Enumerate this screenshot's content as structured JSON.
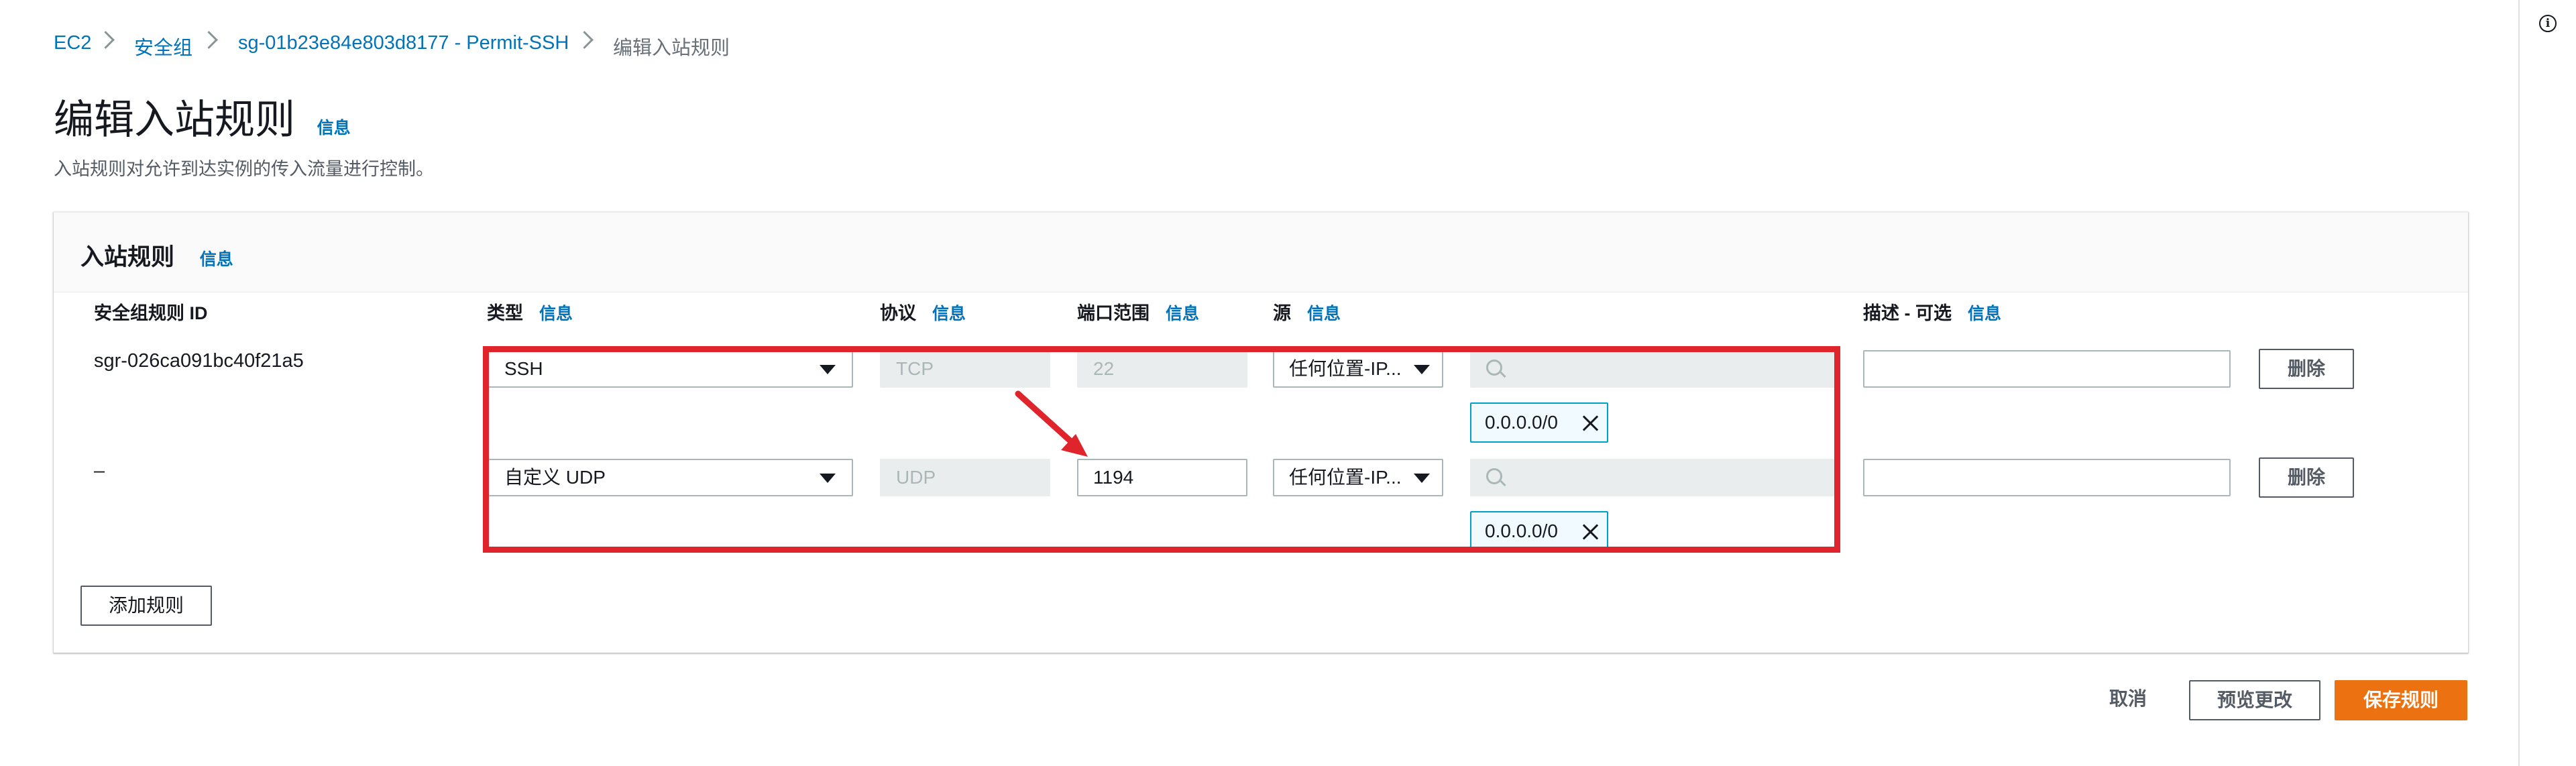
{
  "breadcrumb": {
    "items": [
      "EC2",
      "安全组",
      "sg-01b23e84e803d8177 - Permit-SSH"
    ],
    "current": "编辑入站规则"
  },
  "page": {
    "title": "编辑入站规则",
    "title_info": "信息",
    "subtitle": "入站规则对允许到达实例的传入流量进行控制。"
  },
  "panel": {
    "title": "入站规则",
    "title_info": "信息",
    "columns": {
      "rule_id": "安全组规则 ID",
      "type": "类型",
      "protocol": "协议",
      "port_range": "端口范围",
      "source": "源",
      "description": "描述 - 可选",
      "info": "信息"
    },
    "rules": [
      {
        "rule_id": "sgr-026ca091bc40f21a5",
        "type": "SSH",
        "protocol": "TCP",
        "port_range": "22",
        "source": "任何位置-IP...",
        "cidr": "0.0.0.0/0",
        "description": "",
        "delete_label": "删除"
      },
      {
        "rule_id": "–",
        "type": "自定义 UDP",
        "protocol": "UDP",
        "port_range": "1194",
        "source": "任何位置-IP...",
        "cidr": "0.0.0.0/0",
        "description": "",
        "delete_label": "删除"
      }
    ],
    "add_rule_label": "添加规则"
  },
  "footer": {
    "cancel_label": "取消",
    "preview_label": "预览更改",
    "save_label": "保存规则"
  },
  "colors": {
    "link": "#0073bb",
    "primary": "#ec7211",
    "annotation": "#e0242b"
  },
  "icons": {
    "info": "info-circle-icon",
    "chevron": "chevron-right-icon",
    "caret": "caret-down-icon",
    "search": "search-icon",
    "close": "close-icon"
  }
}
